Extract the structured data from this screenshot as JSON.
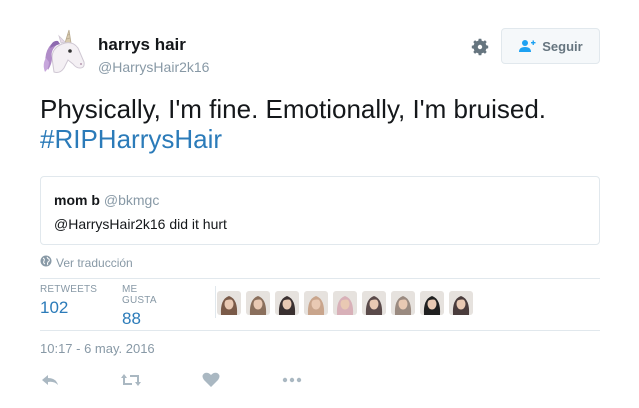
{
  "user": {
    "display_name": "harrys hair",
    "handle": "@HarrysHair2k16",
    "avatar_icon": "unicorn-icon"
  },
  "follow_button": {
    "label": "Seguir",
    "icon": "add-user-icon"
  },
  "settings_icon": "gear-icon",
  "tweet": {
    "text": "Physically, I'm fine. Emotionally, I'm bruised.",
    "hashtag": "#RIPHarrysHair"
  },
  "quoted_tweet": {
    "name": "mom b",
    "handle": "@bkmgc",
    "text": "@HarrysHair2k16 did it hurt"
  },
  "translate_link": {
    "label": "Ver traducción",
    "icon": "globe-icon"
  },
  "stats": {
    "retweets_label": "RETWEETS",
    "retweets_value": "102",
    "likes_label": "ME GUSTA",
    "likes_value": "88"
  },
  "liker_avatars": [
    {
      "name": "liker-avatar-1",
      "tone": "#7a5a48"
    },
    {
      "name": "liker-avatar-2",
      "tone": "#8a6f5c"
    },
    {
      "name": "liker-avatar-3",
      "tone": "#3a3030"
    },
    {
      "name": "liker-avatar-4",
      "tone": "#c9a58c"
    },
    {
      "name": "liker-avatar-5",
      "tone": "#d8b0b8"
    },
    {
      "name": "liker-avatar-6",
      "tone": "#5a4a4a"
    },
    {
      "name": "liker-avatar-7",
      "tone": "#9a8a80"
    },
    {
      "name": "liker-avatar-8",
      "tone": "#202020"
    },
    {
      "name": "liker-avatar-9",
      "tone": "#4a3c3c"
    }
  ],
  "timestamp": "10:17 - 6 may. 2016",
  "actions": [
    "reply-icon",
    "retweet-icon",
    "like-icon",
    "more-icon"
  ],
  "colors": {
    "link": "#2b7bb9",
    "muted": "#8899a6",
    "border": "#e1e8ed",
    "icon": "#aab8c2"
  }
}
